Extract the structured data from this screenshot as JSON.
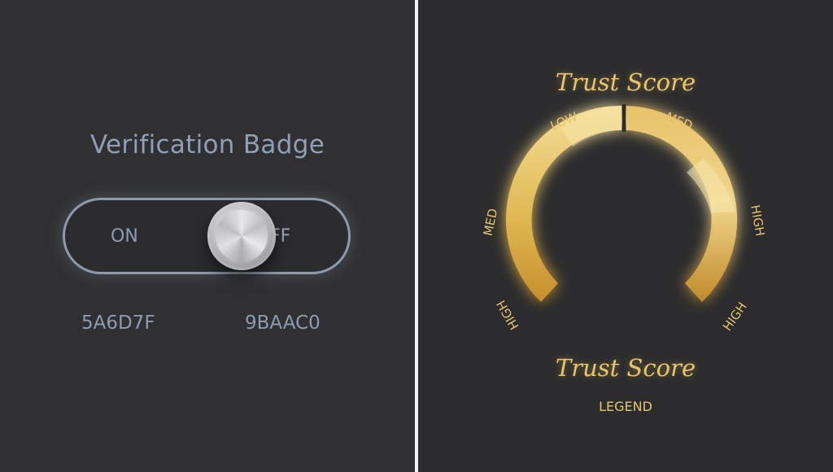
{
  "verification": {
    "title": "Verification Badge",
    "on_label": "ON",
    "off_label": "FF",
    "color_left": "5A6D7F",
    "color_right": "9BAAC0"
  },
  "gauge": {
    "title_top": "Trust Score",
    "title_bottom": "Trust Score",
    "legend": "LEGEND",
    "labels": {
      "low": "LOW",
      "med_top": "MED",
      "high_right": "HIGH",
      "high_bottom": "HIGH",
      "med_left": "MED",
      "high_left_flipped": "HIGH"
    },
    "colors": {
      "gold_light": "#f2dc95",
      "gold_mid": "#ddb24e",
      "gold_dark": "#c58f2c",
      "glow": "#e6be5a"
    }
  }
}
